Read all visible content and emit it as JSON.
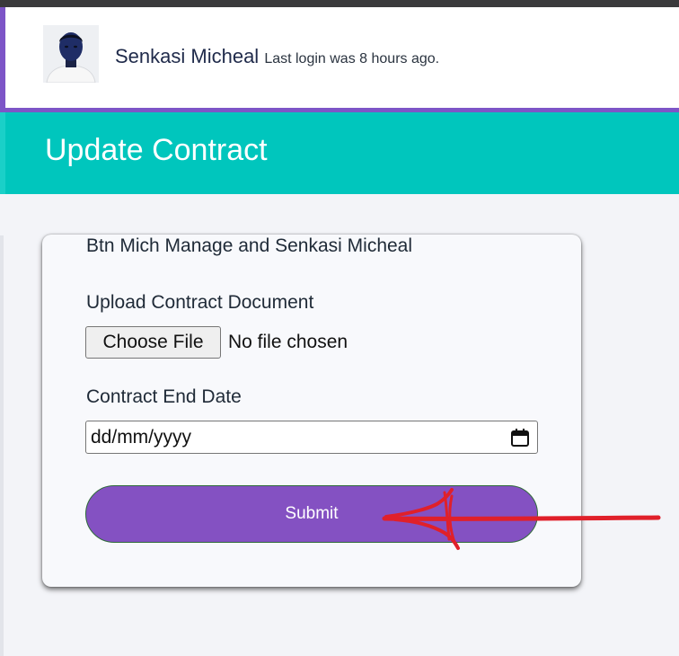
{
  "header": {
    "user_name": "Senkasi Micheal",
    "last_login": "Last login was 8 hours ago."
  },
  "page": {
    "title": "Update Contract"
  },
  "form": {
    "heading": "Btn Mich Manage and Senkasi Micheal",
    "upload_label": "Upload Contract Document",
    "choose_file_label": "Choose File",
    "no_file_text": "No file chosen",
    "end_date_label": "Contract End Date",
    "date_placeholder": "dd/mm/yyyy",
    "submit_label": "Submit"
  },
  "colors": {
    "accent_purple": "#7d55c7",
    "submit_purple": "#8451c2",
    "teal": "#00c6bd",
    "annotation_red": "#e0202a"
  },
  "icons": {
    "date_picker": "calendar-icon",
    "annotation": "red-arrow-annotation"
  }
}
